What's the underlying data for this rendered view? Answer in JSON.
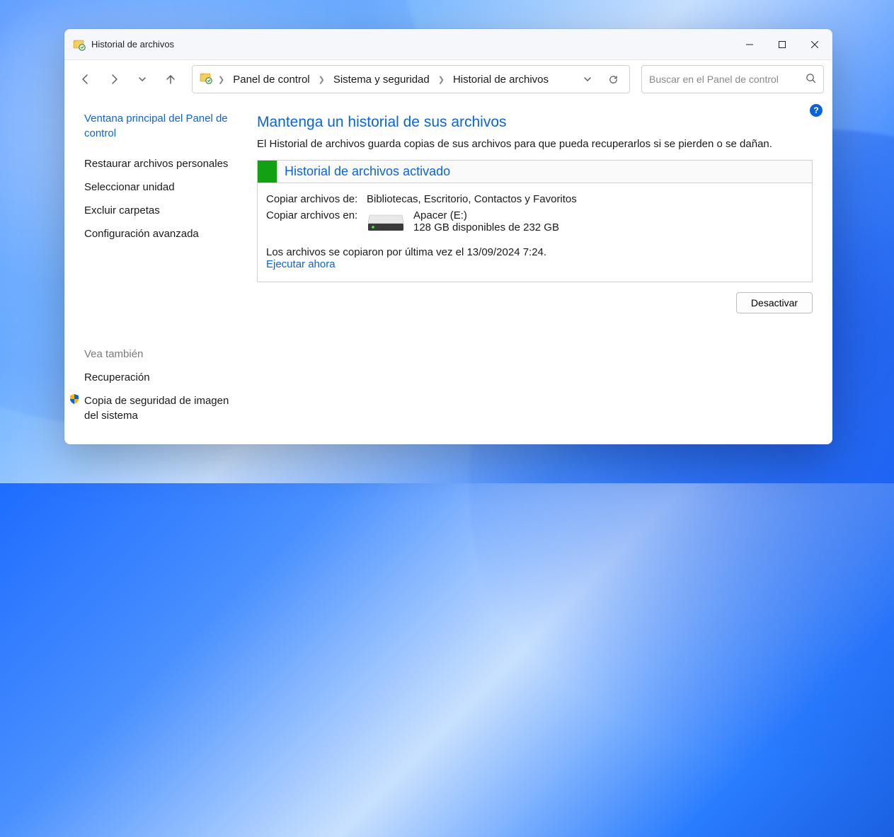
{
  "window": {
    "title": "Historial de archivos"
  },
  "breadcrumb": {
    "items": [
      "Panel de control",
      "Sistema y seguridad",
      "Historial de archivos"
    ]
  },
  "search": {
    "placeholder": "Buscar en el Panel de control"
  },
  "sidebar": {
    "main_link": "Ventana principal del Panel de control",
    "links": [
      "Restaurar archivos personales",
      "Seleccionar unidad",
      "Excluir carpetas",
      "Configuración avanzada"
    ],
    "see_also_header": "Vea también",
    "see_also": [
      "Recuperación",
      "Copia de seguridad de imagen del sistema"
    ]
  },
  "main": {
    "heading": "Mantenga un historial de sus archivos",
    "subheading": "El Historial de archivos guarda copias de sus archivos para que pueda recuperarlos si se pierden o se dañan.",
    "status_title": "Historial de archivos activado",
    "copy_from_label": "Copiar archivos de:",
    "copy_from_value": "Bibliotecas, Escritorio, Contactos y Favoritos",
    "copy_to_label": "Copiar archivos en:",
    "drive_name": "Apacer (E:)",
    "drive_space": "128 GB disponibles de 232 GB",
    "last_copy": "Los archivos se copiaron por última vez el 13/09/2024 7:24.",
    "run_now": "Ejecutar ahora",
    "deactivate_btn": "Desactivar"
  },
  "colors": {
    "accent": "#0a64d8",
    "status_green": "#12a112"
  }
}
